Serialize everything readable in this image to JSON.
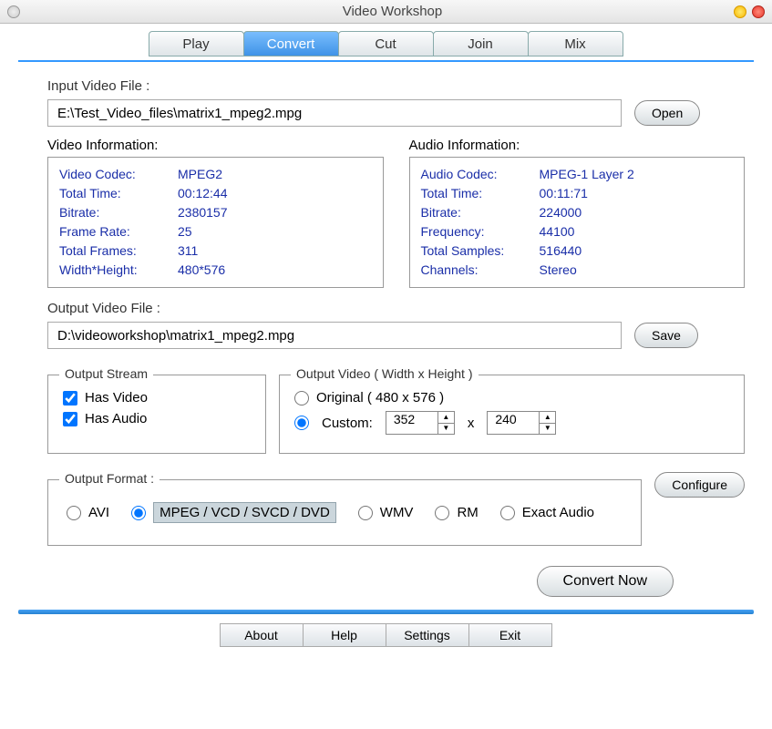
{
  "title": "Video Workshop",
  "tabs": {
    "play": "Play",
    "convert": "Convert",
    "cut": "Cut",
    "join": "Join",
    "mix": "Mix"
  },
  "input": {
    "label": "Input Video File :",
    "path": "E:\\Test_Video_files\\matrix1_mpeg2.mpg",
    "open": "Open"
  },
  "video_info": {
    "title": "Video Information:",
    "rows": [
      {
        "k": "Video Codec:",
        "v": "MPEG2"
      },
      {
        "k": "Total Time:",
        "v": "00:12:44"
      },
      {
        "k": "Bitrate:",
        "v": "2380157"
      },
      {
        "k": "Frame Rate:",
        "v": "25"
      },
      {
        "k": "Total Frames:",
        "v": "311"
      },
      {
        "k": "Width*Height:",
        "v": "480*576"
      }
    ]
  },
  "audio_info": {
    "title": "Audio Information:",
    "rows": [
      {
        "k": "Audio Codec:",
        "v": "MPEG-1 Layer 2"
      },
      {
        "k": "Total Time:",
        "v": "00:11:71"
      },
      {
        "k": "Bitrate:",
        "v": "224000"
      },
      {
        "k": "Frequency:",
        "v": "44100"
      },
      {
        "k": "Total Samples:",
        "v": "516440"
      },
      {
        "k": "Channels:",
        "v": "Stereo"
      }
    ]
  },
  "output": {
    "label": "Output Video File :",
    "path": "D:\\videoworkshop\\matrix1_mpeg2.mpg",
    "save": "Save"
  },
  "stream": {
    "title": "Output Stream",
    "has_video": "Has Video",
    "has_audio": "Has Audio"
  },
  "out_video": {
    "title": "Output Video ( Width x Height )",
    "original": "Original ( 480 x 576 )",
    "custom": "Custom:",
    "w": "352",
    "h": "240",
    "by": "x"
  },
  "format": {
    "title": "Output Format :",
    "configure": "Configure",
    "avi": "AVI",
    "mpeg": "MPEG / VCD / SVCD / DVD",
    "wmv": "WMV",
    "rm": "RM",
    "exact": "Exact Audio"
  },
  "convert_now": "Convert Now",
  "bottom": {
    "about": "About",
    "help": "Help",
    "settings": "Settings",
    "exit": "Exit"
  }
}
